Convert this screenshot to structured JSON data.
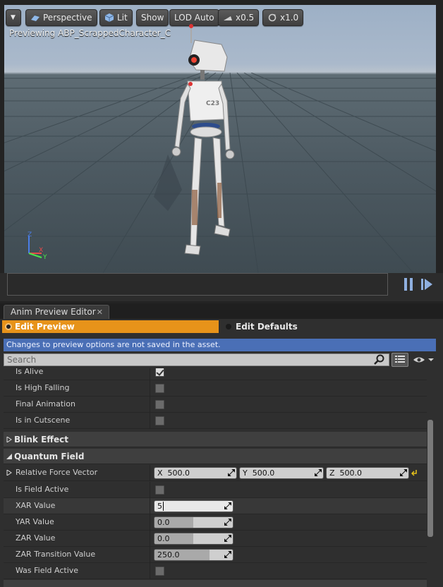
{
  "viewport": {
    "buttons": {
      "perspective": "Perspective",
      "lit": "Lit",
      "show": "Show",
      "lod": "LOD Auto",
      "speed": "x0.5",
      "rate": "x1.0"
    },
    "preview_label": "Previewing ABP_ScrappedCharacter_C",
    "axes": {
      "z": "Z",
      "x": "X",
      "y": "Y"
    }
  },
  "tab": {
    "label": "Anim Preview Editor",
    "close": "✕"
  },
  "panel": {
    "edit_preview": "Edit Preview",
    "edit_defaults": "Edit Defaults",
    "notice": "Changes to preview options are not saved in the asset.",
    "search_placeholder": "Search"
  },
  "rows": {
    "is_alive": "Is Alive",
    "is_high_falling": "Is High Falling",
    "final_animation": "Final Animation",
    "is_in_cutscene": "Is in Cutscene",
    "blink_effect": "Blink Effect",
    "quantum_field": "Quantum Field",
    "relative_force_vector": "Relative Force Vector",
    "is_field_active": "Is Field Active",
    "xar_value": "XAR Value",
    "yar_value": "YAR Value",
    "zar_value": "ZAR Value",
    "zar_transition_value": "ZAR Transition Value",
    "was_field_active": "Was Field Active"
  },
  "values": {
    "is_alive": true,
    "is_high_falling": false,
    "final_animation": false,
    "is_in_cutscene": false,
    "is_field_active": false,
    "was_field_active": false,
    "vector_x_label": "X",
    "vector_x": "500.0",
    "vector_y_label": "Y",
    "vector_y": "500.0",
    "vector_z_label": "Z",
    "vector_z": "500.0",
    "xar": "5",
    "yar": "0.0",
    "zar": "0.0",
    "zar_transition": "250.0"
  },
  "colors": {
    "accent": "#e7931a",
    "notice": "#4a6fb6"
  }
}
